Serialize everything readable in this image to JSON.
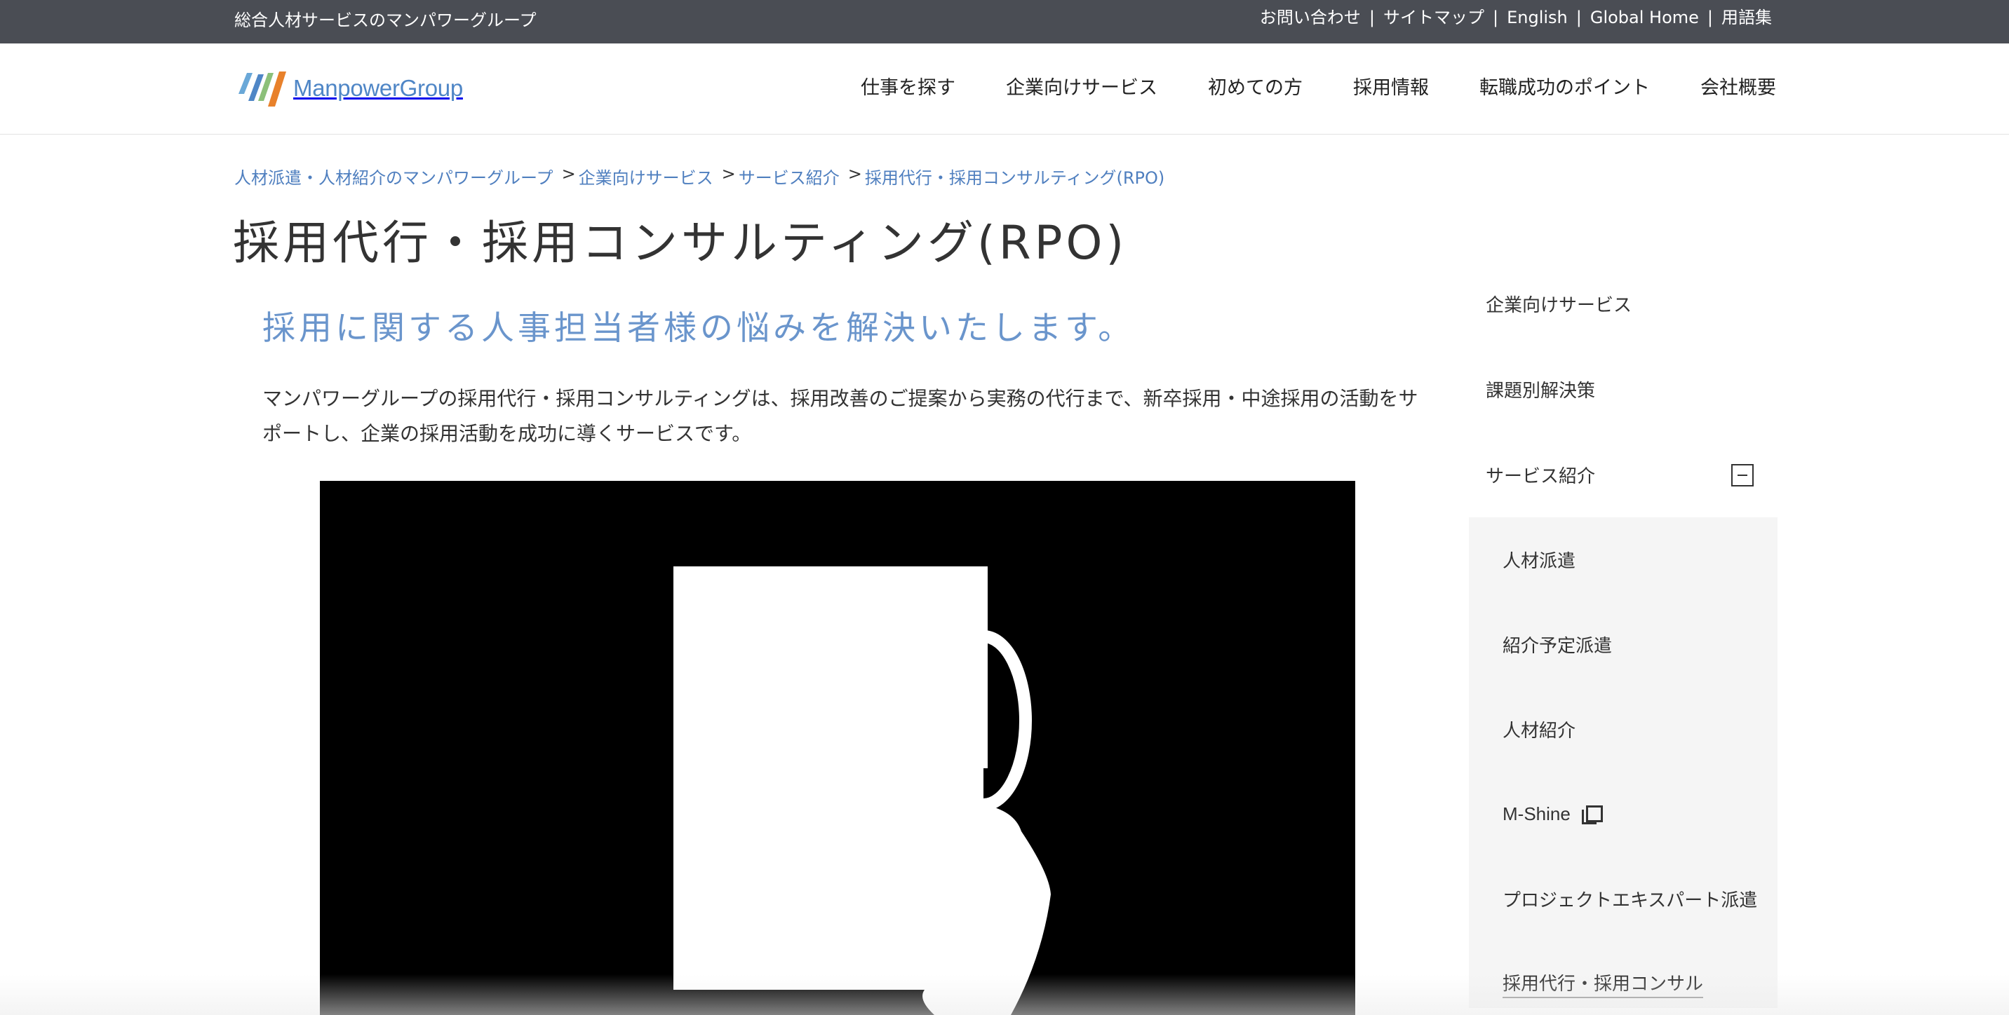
{
  "topbar": {
    "tagline": "総合人材サービスのマンパワーグループ",
    "links": [
      "お問い合わせ",
      "サイトマップ",
      "English",
      "Global Home",
      "用語集"
    ],
    "separator": "|"
  },
  "header": {
    "logo_text": "ManpowerGroup",
    "nav": [
      "仕事を探す",
      "企業向けサービス",
      "初めての方",
      "採用情報",
      "転職成功のポイント",
      "会社概要"
    ]
  },
  "breadcrumb": [
    "人材派遣・人材紹介のマンパワーグループ",
    "企業向けサービス",
    "サービス紹介",
    "採用代行・採用コンサルティング(RPO)"
  ],
  "breadcrumb_sep": ">",
  "main": {
    "title": "採用代行・採用コンサルティング(RPO)",
    "lead": "採用に関する人事担当者様の悩みを解決いたします。",
    "intro": "マンパワーグループの採用代行・採用コンサルティングは、採用改善のご提案から実務の代行まで、新卒採用・中途採用の活動をサポートし、企業の採用活動を成功に導くサービスです。"
  },
  "sidebar": {
    "items": [
      "企業向けサービス",
      "課題別解決策",
      "サービス紹介"
    ],
    "subitems": [
      "人材派遣",
      "紹介予定派遣",
      "人材紹介",
      "M-Shine",
      "プロジェクトエキスパート派遣",
      "採用代行・採用コンサル"
    ]
  },
  "colors": {
    "topbar_bg": "#4a4d54",
    "link_blue": "#4f7fbf",
    "lead_blue": "#6a95cc",
    "subnav_bg": "#f5f5f5",
    "video_bg": "#000000"
  },
  "icons": {
    "logo": "manpowergroup-logo",
    "sidebar_toggle": "minus-box-icon",
    "external_link": "external-window-icon"
  }
}
